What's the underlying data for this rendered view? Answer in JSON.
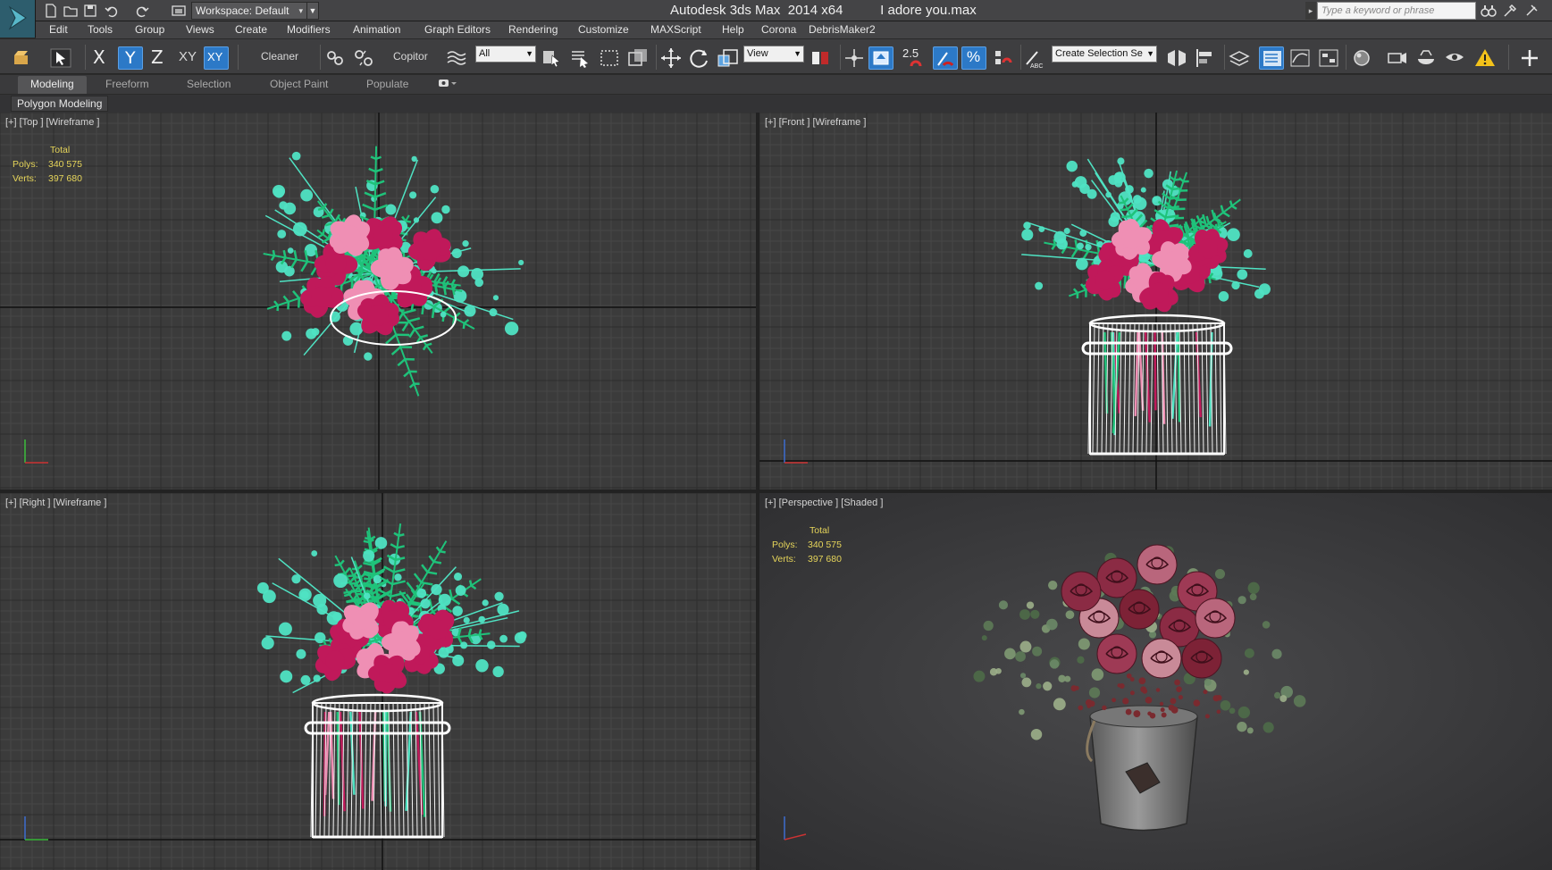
{
  "titlebar": {
    "workspace": "Workspace: Default",
    "app_name": "Autodesk 3ds Max  2014 x64",
    "file_name": "I adore you.max",
    "search_placeholder": "Type a keyword or phrase"
  },
  "menu": [
    "Edit",
    "Tools",
    "Group",
    "Views",
    "Create",
    "Modifiers",
    "Animation",
    "Graph Editors",
    "Rendering",
    "Customize",
    "MAXScript",
    "Help",
    "Corona",
    "DebrisMaker2"
  ],
  "toolbar": {
    "axis_x": "X",
    "axis_y": "Y",
    "axis_z": "Z",
    "axis_xy": "XY",
    "axis_xy_active": "XY",
    "cleaner": "Cleaner",
    "copitor": "Copitor",
    "selection_filter": "All",
    "ref_coord": "View",
    "angle_snap": "2.5",
    "named_selection": "Create Selection Se"
  },
  "ribbon": {
    "tabs": [
      "Modeling",
      "Freeform",
      "Selection",
      "Object Paint",
      "Populate"
    ],
    "active_tab": "Modeling",
    "panel_label": "Polygon Modeling"
  },
  "viewports": {
    "top": {
      "label": "[+] [Top ] [Wireframe ]"
    },
    "front": {
      "label": "[+] [Front ] [Wireframe ]"
    },
    "right": {
      "label": "[+] [Right ] [Wireframe ]"
    },
    "perspective": {
      "label": "[+] [Perspective ] [Shaded ]"
    }
  },
  "stats": {
    "total_label": "Total",
    "polys_label": "Polys:",
    "polys_value": "340 575",
    "verts_label": "Verts:",
    "verts_value": "397 680"
  },
  "colors": {
    "accent_blue": "#2c79c7",
    "stats_yellow": "#e6d55a",
    "active_viewport_border": "#b59a3c",
    "wire_green": "#1fc27a",
    "wire_teal": "#4fe3c3",
    "wire_magenta": "#c0195a",
    "wire_pink": "#ef8fb4"
  }
}
